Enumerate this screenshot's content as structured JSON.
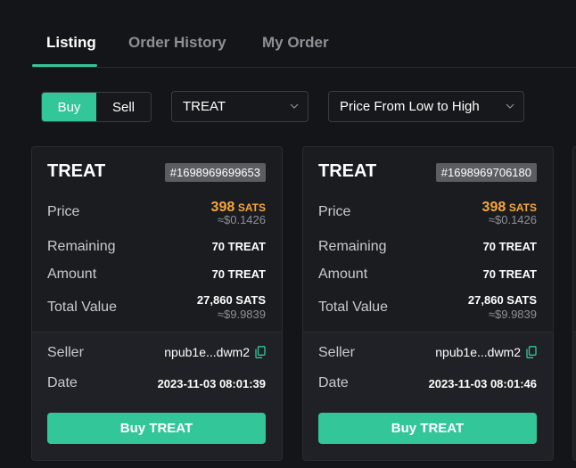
{
  "tabs": [
    {
      "label": "Listing",
      "active": true
    },
    {
      "label": "Order History",
      "active": false
    },
    {
      "label": "My Order",
      "active": false
    }
  ],
  "filters": {
    "side_options": [
      {
        "label": "Buy",
        "active": true
      },
      {
        "label": "Sell",
        "active": false
      }
    ],
    "token_select": {
      "value": "TREAT"
    },
    "sort_select": {
      "value": "Price From Low to High"
    }
  },
  "labels": {
    "price": "Price",
    "remaining": "Remaining",
    "amount": "Amount",
    "total_value": "Total Value",
    "seller": "Seller",
    "date": "Date"
  },
  "cards": [
    {
      "name": "TREAT",
      "inscription": "#1698969699653",
      "price_value": "398",
      "price_unit": "SATS",
      "price_usd": "≈$0.1426",
      "remaining": "70 TREAT",
      "amount": "70 TREAT",
      "total_value": "27,860 SATS",
      "total_usd": "≈$9.9839",
      "seller": "npub1e...dwm2",
      "date": "2023-11-03 08:01:39",
      "buy_label": "Buy TREAT"
    },
    {
      "name": "TREAT",
      "inscription": "#1698969706180",
      "price_value": "398",
      "price_unit": "SATS",
      "price_usd": "≈$0.1426",
      "remaining": "70 TREAT",
      "amount": "70 TREAT",
      "total_value": "27,860 SATS",
      "total_usd": "≈$9.9839",
      "seller": "npub1e...dwm2",
      "date": "2023-11-03 08:01:46",
      "buy_label": "Buy TREAT"
    }
  ],
  "colors": {
    "accent": "#33c699",
    "price": "#f6a63a",
    "background": "#141518",
    "card": "#1b1c20"
  },
  "icons": {
    "copy": "copy-icon",
    "dropdown": "chevron-down-icon"
  }
}
